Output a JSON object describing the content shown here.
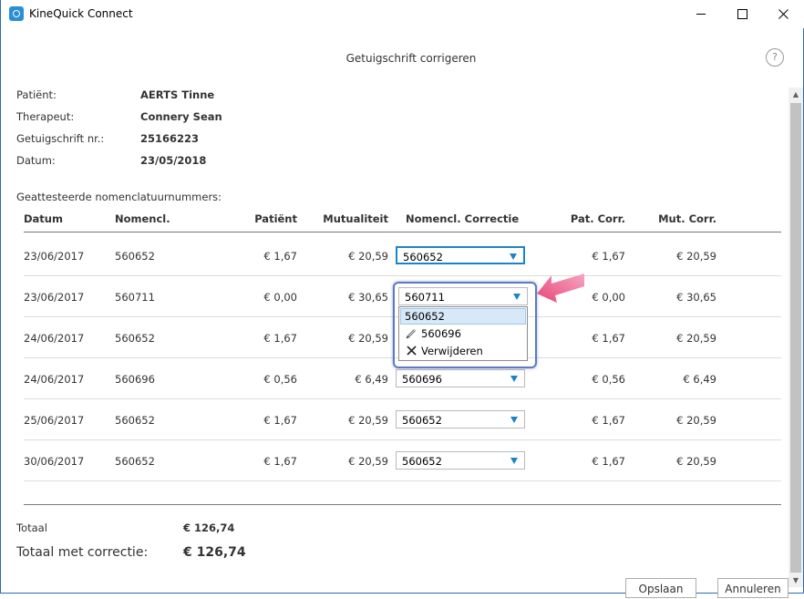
{
  "window": {
    "app_title": "KineQuick Connect",
    "dialog_title": "Getuigschrift corrigeren",
    "help_symbol": "?"
  },
  "info": {
    "patient_label": "Patiënt:",
    "patient_value": "AERTS Tinne",
    "therapist_label": "Therapeut:",
    "therapist_value": "Connery Sean",
    "cert_label": "Getuigschrift nr.:",
    "cert_value": "25166223",
    "date_label": "Datum:",
    "date_value": "23/05/2018"
  },
  "section_label": "Geattesteerde nomenclatuurnummers:",
  "table": {
    "headers": {
      "datum": "Datum",
      "nomencl": "Nomencl.",
      "patient": "Patiënt",
      "mutualiteit": "Mutualiteit",
      "correctie": "Nomencl. Correctie",
      "pat_corr": "Pat. Corr.",
      "mut_corr": "Mut. Corr."
    },
    "rows": [
      {
        "datum": "23/06/2017",
        "nomencl": "560652",
        "patient": "€ 1,67",
        "mutualiteit": "€ 20,59",
        "correctie": "560652",
        "pat_corr": "€ 1,67",
        "mut_corr": "€ 20,59"
      },
      {
        "datum": "23/06/2017",
        "nomencl": "560711",
        "patient": "€ 0,00",
        "mutualiteit": "€ 30,65",
        "correctie": "560711",
        "pat_corr": "€ 0,00",
        "mut_corr": "€ 30,65"
      },
      {
        "datum": "24/06/2017",
        "nomencl": "560652",
        "patient": "€ 1,67",
        "mutualiteit": "€ 20,59",
        "correctie": "",
        "pat_corr": "€ 1,67",
        "mut_corr": "€ 20,59"
      },
      {
        "datum": "24/06/2017",
        "nomencl": "560696",
        "patient": "€ 0,56",
        "mutualiteit": "€ 6,49",
        "correctie": "560696",
        "pat_corr": "€ 0,56",
        "mut_corr": "€ 6,49"
      },
      {
        "datum": "25/06/2017",
        "nomencl": "560652",
        "patient": "€ 1,67",
        "mutualiteit": "€ 20,59",
        "correctie": "560652",
        "pat_corr": "€ 1,67",
        "mut_corr": "€ 20,59"
      },
      {
        "datum": "30/06/2017",
        "nomencl": "560652",
        "patient": "€ 1,67",
        "mutualiteit": "€ 20,59",
        "correctie": "560652",
        "pat_corr": "€ 1,67",
        "mut_corr": "€ 20,59"
      }
    ]
  },
  "dropdown": {
    "options": [
      "560652",
      "560696",
      "Verwijderen"
    ],
    "option_icons": [
      "",
      "pencil-icon",
      "close-icon"
    ]
  },
  "totals": {
    "totaal_label": "Totaal",
    "totaal_value": "€ 126,74",
    "tmc_label": "Totaal met correctie:",
    "tmc_value": "€ 126,74"
  },
  "buttons": {
    "save": "Opslaan",
    "cancel": "Annuleren"
  },
  "colors": {
    "accent": "#1c84c6",
    "highlight_frame": "#5a7cc2",
    "pointer_arrow": "#e8457a"
  }
}
